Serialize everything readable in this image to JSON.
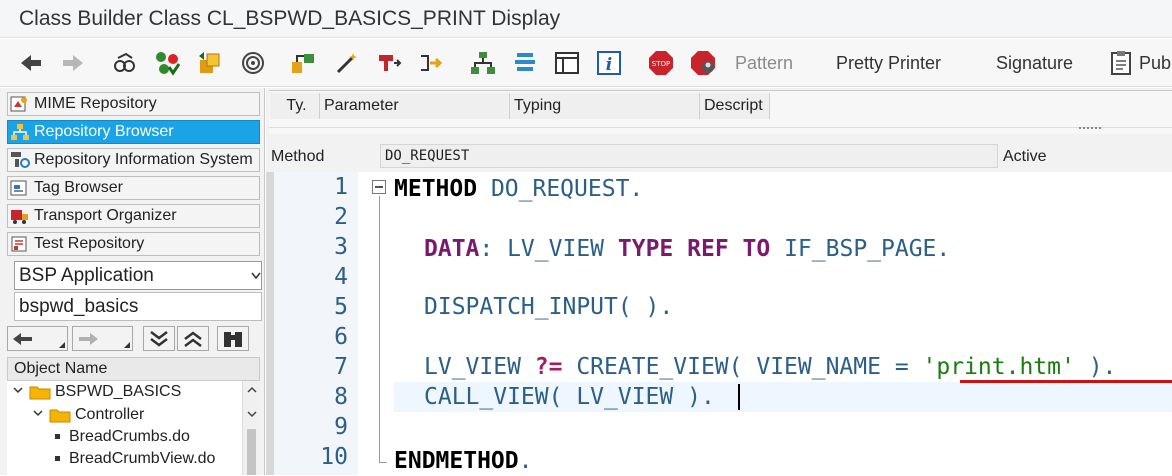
{
  "window": {
    "title": "Class Builder Class CL_BSPWD_BASICS_PRINT Display"
  },
  "toolbar": {
    "icons": [
      "back-icon",
      "forward-icon",
      "other-object-icon",
      "check-icon",
      "activate-icon",
      "where-used-icon",
      "object-list-icon",
      "wand-icon",
      "display-object-icon",
      "navigation-icon",
      "hierarchy-icon",
      "stack-icon",
      "document-icon",
      "info-icon",
      "stop-icon",
      "stop-user-icon"
    ],
    "pattern": "Pattern",
    "pretty_printer": "Pretty Printer",
    "signature": "Signature",
    "pub": "Pub"
  },
  "sidebar": {
    "items": [
      {
        "label": "MIME Repository",
        "icon": "mime-icon",
        "selected": false
      },
      {
        "label": "Repository Browser",
        "icon": "repository-browser-icon",
        "selected": true
      },
      {
        "label": "Repository Information System",
        "icon": "info-system-icon",
        "selected": false
      },
      {
        "label": "Tag Browser",
        "icon": "tag-browser-icon",
        "selected": false
      },
      {
        "label": "Transport Organizer",
        "icon": "transport-icon",
        "selected": false
      },
      {
        "label": "Test Repository",
        "icon": "test-repository-icon",
        "selected": false
      }
    ],
    "object_type": "BSP Application",
    "object_name": "bspwd_basics",
    "tree_header": "Object Name",
    "tree": [
      {
        "label": "BSPWD_BASICS",
        "level": 0,
        "type": "folder"
      },
      {
        "label": "Controller",
        "level": 1,
        "type": "folder"
      },
      {
        "label": "BreadCrumbs.do",
        "level": 2,
        "type": "file"
      },
      {
        "label": "BreadCrumbView.do",
        "level": 2,
        "type": "file"
      }
    ]
  },
  "params": {
    "columns": [
      "Ty.",
      "Parameter",
      "Typing",
      "Descript"
    ]
  },
  "method": {
    "label": "Method",
    "value": "DO_REQUEST",
    "status": "Active"
  },
  "editor": {
    "line_numbers": [
      "1",
      "2",
      "3",
      "4",
      "5",
      "6",
      "7",
      "8",
      "9",
      "10"
    ],
    "l1_kw": "METHOD",
    "l1_rest": " DO_REQUEST.",
    "l3_data": "DATA",
    "l3_a": ": LV_VIEW ",
    "l3_type": "TYPE",
    "l3_ref": "REF",
    "l3_to": "TO",
    "l3_b": " IF_BSP_PAGE.",
    "l5": "DISPATCH_INPUT( ).",
    "l7_a": "LV_VIEW ",
    "l7_op": "?=",
    "l7_b": " CREATE_VIEW( VIEW_NAME = ",
    "l7_str": "'print.htm'",
    "l7_c": " ).",
    "l8": "CALL_VIEW( LV_VIEW ).",
    "l10_kw": "ENDMETHOD",
    "l10_rest": "."
  },
  "colors": {
    "selected": "#1aa3e6",
    "keyword": "#000000",
    "string": "#1a7b0f",
    "identifier": "#2c5f88",
    "underline": "#cc1111"
  }
}
